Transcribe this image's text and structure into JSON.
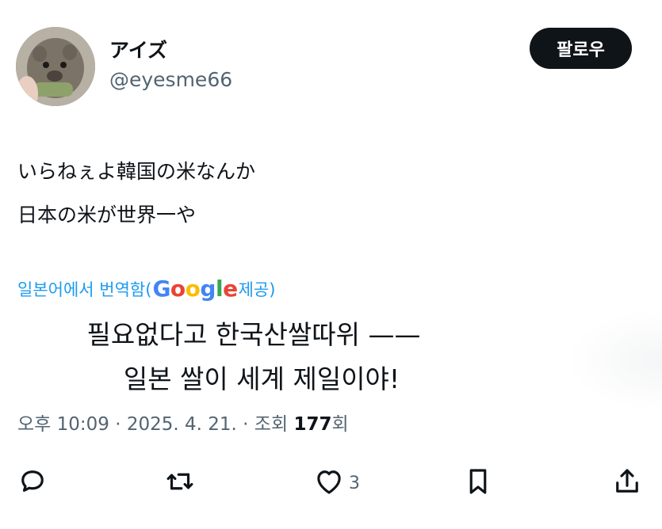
{
  "author": {
    "display_name": "アイズ",
    "handle": "@eyesme66"
  },
  "follow_button": {
    "label": "팔로우"
  },
  "tweet": {
    "lines": [
      "いらねぇよ韓国の米なんか",
      "日本の米が世界一や"
    ]
  },
  "translation": {
    "source_prefix": "일본어에서 번역함(",
    "provider": "Google",
    "source_suffix": " 제공)",
    "lines": [
      "필요없다고 한국산쌀따위 ——",
      "일본 쌀이 세계 제일이야!"
    ]
  },
  "meta": {
    "time": "오후 10:09",
    "date": "2025. 4. 21.",
    "views_label": "조회",
    "views_count": "177",
    "views_suffix": "회",
    "separator": " · "
  },
  "actions": {
    "reply_icon": "reply-icon",
    "retweet_icon": "retweet-icon",
    "like_icon": "heart-icon",
    "like_count": "3",
    "bookmark_icon": "bookmark-icon",
    "share_icon": "share-icon"
  },
  "colors": {
    "text": "#0f1419",
    "secondary": "#536471",
    "link": "#1d9bf0",
    "button_bg": "#0f1419"
  }
}
